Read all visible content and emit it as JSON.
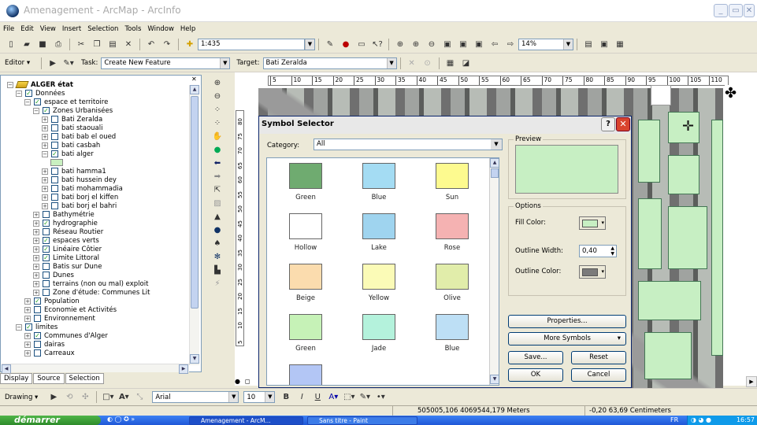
{
  "window": {
    "title": "Amenagement - ArcMap - ArcInfo"
  },
  "menu": [
    "File",
    "Edit",
    "View",
    "Insert",
    "Selection",
    "Tools",
    "Window",
    "Help"
  ],
  "toolbar": {
    "scale": "1:435",
    "zoom_pct": "14%"
  },
  "editor_bar": {
    "editor_label": "Editor ▾",
    "task_label": "Task:",
    "task_value": "Create New Feature",
    "target_label": "Target:",
    "target_value": "Bati Zeralda"
  },
  "toc": {
    "rows": [
      {
        "label": "ALGER état",
        "level": 0,
        "exp": "-",
        "chk": "none",
        "bold": true,
        "icon": "layers-icon"
      },
      {
        "label": "Données",
        "level": 1,
        "exp": "-",
        "chk": "on"
      },
      {
        "label": "espace et territoire",
        "level": 2,
        "exp": "-",
        "chk": "on"
      },
      {
        "label": "Zones Urbanisées",
        "level": 3,
        "exp": "-",
        "chk": "on"
      },
      {
        "label": "Bati Zeralda",
        "level": 4,
        "exp": "+",
        "chk": "off"
      },
      {
        "label": "bati staouali",
        "level": 4,
        "exp": "+",
        "chk": "off"
      },
      {
        "label": "bati bab el oued",
        "level": 4,
        "exp": "+",
        "chk": "off"
      },
      {
        "label": "bati casbah",
        "level": 4,
        "exp": "+",
        "chk": "off"
      },
      {
        "label": "bati alger",
        "level": 4,
        "exp": "-",
        "chk": "on"
      },
      {
        "label": "",
        "level": 5,
        "exp": "none",
        "chk": "none",
        "swatch": true
      },
      {
        "label": "bati hamma1",
        "level": 4,
        "exp": "+",
        "chk": "off"
      },
      {
        "label": "bati hussein dey",
        "level": 4,
        "exp": "+",
        "chk": "off"
      },
      {
        "label": "bati mohammadia",
        "level": 4,
        "exp": "+",
        "chk": "off"
      },
      {
        "label": "bati borj el kiffen",
        "level": 4,
        "exp": "+",
        "chk": "off"
      },
      {
        "label": "bati borj el bahri",
        "level": 4,
        "exp": "+",
        "chk": "off"
      },
      {
        "label": "Bathymétrie",
        "level": 3,
        "exp": "+",
        "chk": "off"
      },
      {
        "label": "hydrographie",
        "level": 3,
        "exp": "+",
        "chk": "on"
      },
      {
        "label": "Réseau Routier",
        "level": 3,
        "exp": "+",
        "chk": "off"
      },
      {
        "label": "espaces verts",
        "level": 3,
        "exp": "+",
        "chk": "on"
      },
      {
        "label": "Linéaire Côtier",
        "level": 3,
        "exp": "+",
        "chk": "on"
      },
      {
        "label": "Limite Littoral",
        "level": 3,
        "exp": "+",
        "chk": "on"
      },
      {
        "label": "Batis sur Dune",
        "level": 3,
        "exp": "+",
        "chk": "off"
      },
      {
        "label": "Dunes",
        "level": 3,
        "exp": "+",
        "chk": "off"
      },
      {
        "label": "terrains (non ou mal) exploit",
        "level": 3,
        "exp": "+",
        "chk": "off"
      },
      {
        "label": "Zone d'étude: Communes Lit",
        "level": 3,
        "exp": "+",
        "chk": "off"
      },
      {
        "label": "Population",
        "level": 2,
        "exp": "+",
        "chk": "on"
      },
      {
        "label": "Economie et Activités",
        "level": 2,
        "exp": "+",
        "chk": "off"
      },
      {
        "label": "Environnement",
        "level": 2,
        "exp": "+",
        "chk": "off"
      },
      {
        "label": "limites",
        "level": 1,
        "exp": "-",
        "chk": "on"
      },
      {
        "label": "Communes d'Alger",
        "level": 2,
        "exp": "+",
        "chk": "on"
      },
      {
        "label": "dairas",
        "level": 2,
        "exp": "+",
        "chk": "off"
      },
      {
        "label": "Carreaux",
        "level": 2,
        "exp": "+",
        "chk": "off"
      }
    ],
    "tabs": [
      "Display",
      "Source",
      "Selection"
    ]
  },
  "ruler": {
    "ticks": [
      "5",
      "10",
      "15",
      "20",
      "25",
      "30",
      "35",
      "40",
      "45",
      "50",
      "55",
      "60",
      "65",
      "70",
      "75",
      "80",
      "85",
      "90",
      "95",
      "100",
      "105",
      "110"
    ]
  },
  "vruler": {
    "ticks": [
      "80",
      "75",
      "70",
      "65",
      "60",
      "55",
      "50",
      "45",
      "40",
      "35",
      "30",
      "25",
      "20",
      "15",
      "10",
      "5"
    ]
  },
  "dialog": {
    "title": "Symbol Selector",
    "category_label": "Category:",
    "category_value": "All",
    "symbols": [
      {
        "name": "Green",
        "color": "#6fab70"
      },
      {
        "name": "Blue",
        "color": "#a4dcf3"
      },
      {
        "name": "Sun",
        "color": "#fdfa8f"
      },
      {
        "name": "Hollow",
        "color": "#ffffff"
      },
      {
        "name": "Lake",
        "color": "#9fd4ef"
      },
      {
        "name": "Rose",
        "color": "#f5b2b2"
      },
      {
        "name": "Beige",
        "color": "#fbdcae"
      },
      {
        "name": "Yellow",
        "color": "#fbfbb7"
      },
      {
        "name": "Olive",
        "color": "#e1edaa"
      },
      {
        "name": "Green",
        "color": "#c6f2b7"
      },
      {
        "name": "Jade",
        "color": "#b4f2dc"
      },
      {
        "name": "Blue",
        "color": "#bddff5"
      },
      {
        "name": "",
        "color": "#b3c6f5"
      }
    ],
    "preview_label": "Preview",
    "preview_color": "#c7efc3",
    "options_label": "Options",
    "fill_color_label": "Fill Color:",
    "fill_color": "#c7efc3",
    "outline_width_label": "Outline Width:",
    "outline_width": "0,40",
    "outline_color_label": "Outline Color:",
    "outline_color": "#7b7b7b",
    "properties_btn": "Properties...",
    "more_symbols_btn": "More Symbols",
    "save_btn": "Save...",
    "reset_btn": "Reset",
    "ok_btn": "OK",
    "cancel_btn": "Cancel"
  },
  "drawing_bar": {
    "drawing_label": "Drawing ▾",
    "font": "Arial",
    "size": "10"
  },
  "status": {
    "coords_map": "505005,106  4069544,179 Meters",
    "coords_page": "-0,20  63,69 Centimeters"
  },
  "taskbar": {
    "start": "démarrer",
    "tasks": [
      "Amenagement - ArcM...",
      "Sans titre - Paint"
    ],
    "lang": "FR",
    "clock": "16:57"
  }
}
